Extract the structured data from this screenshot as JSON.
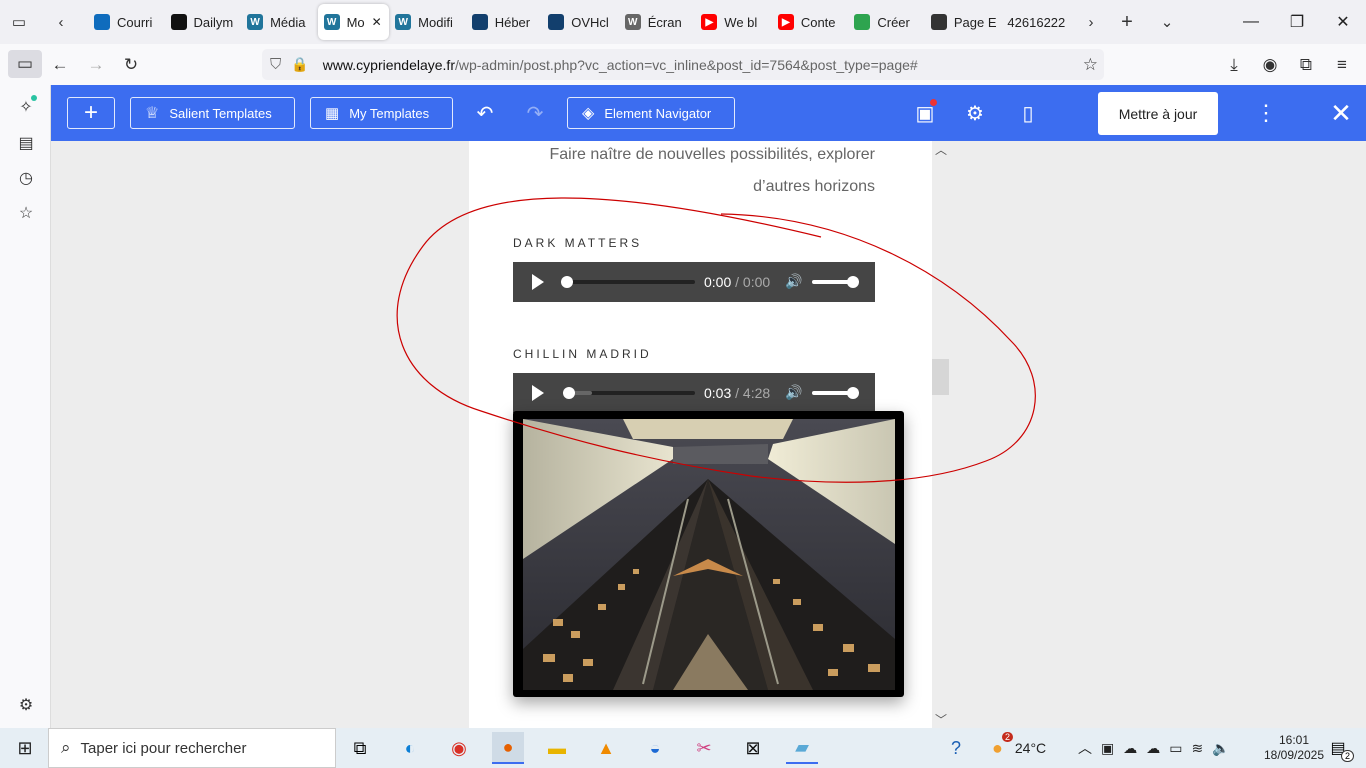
{
  "tabs": [
    {
      "label": "Courri",
      "icon": "outlook-icon",
      "color": "#0f6cbd"
    },
    {
      "label": "Dailym",
      "icon": "dailymotion-icon",
      "color": "#111111"
    },
    {
      "label": "Média",
      "icon": "wordpress-icon",
      "color": "#21759b"
    },
    {
      "label": "Mo",
      "icon": "wordpress-icon",
      "color": "#21759b",
      "active": true
    },
    {
      "label": "Modifi",
      "icon": "wordpress-icon",
      "color": "#21759b"
    },
    {
      "label": "Héber",
      "icon": "ovh-icon",
      "color": "#123f6d"
    },
    {
      "label": "OVHcl",
      "icon": "ovh-icon",
      "color": "#123f6d"
    },
    {
      "label": "Écran",
      "icon": "wordpress-icon",
      "color": "#666666"
    },
    {
      "label": "We bl",
      "icon": "youtube-icon",
      "color": "#ff0000"
    },
    {
      "label": "Conte",
      "icon": "youtube-icon",
      "color": "#ff0000"
    },
    {
      "label": "Créer",
      "icon": "canva-icon",
      "color": "#2ea44f"
    },
    {
      "label": "Page E",
      "icon": "page-icon",
      "color": "#333333"
    },
    {
      "label": "42616222",
      "icon": "",
      "color": ""
    }
  ],
  "address": {
    "host": "www.cypriendelaye.fr",
    "path": "/wp-admin/post.php?vc_action=vc_inline&post_id=7564&post_type=page#"
  },
  "vc": {
    "salient_label": "Salient Templates",
    "my_templates_label": "My Templates",
    "navigator_label": "Element Navigator",
    "update_label": "Mettre à jour"
  },
  "content": {
    "tagline_line1": "Faire naître de nouvelles possibilités, explorer",
    "tagline_line2": "d’autres horizons",
    "tracks": [
      {
        "title": "DARK MATTERS",
        "current": "0:00",
        "duration": "0:00",
        "progress": 0
      },
      {
        "title": "CHILLIN MADRID",
        "current": "0:03",
        "duration": "4:28",
        "progress": 0.012
      }
    ]
  },
  "taskbar": {
    "search_placeholder": "Taper ici pour rechercher",
    "weather_temp": "24°C",
    "weather_badge": "2",
    "time": "16:01",
    "date": "18/09/2025",
    "notif_count": "2"
  },
  "colors": {
    "vc_bar": "#3c6df0",
    "annotation": "#cc0000"
  }
}
